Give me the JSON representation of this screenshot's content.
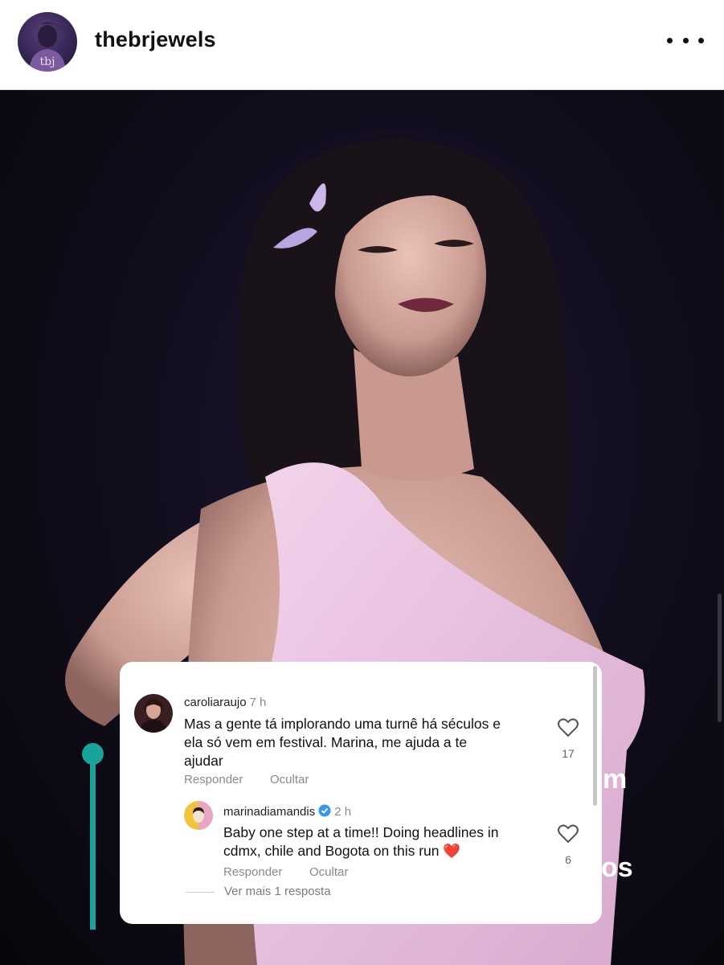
{
  "header": {
    "username": "thebrjewels",
    "avatar_text": "tbj",
    "more_icon": "more-horizontal-icon"
  },
  "overlay_text": {
    "fragment_1": "m",
    "fragment_2": "os"
  },
  "comments": [
    {
      "username": "caroliaraujo",
      "time": "7 h",
      "text_lines": [
        "Mas a gente tá implorando uma turnê há séculos e",
        "ela só vem em festival. Marina, me ajuda a te",
        "ajudar"
      ],
      "likes": "17",
      "reply_label": "Responder",
      "hide_label": "Ocultar"
    },
    {
      "username": "marinadiamandis",
      "verified": true,
      "time": "2 h",
      "text_lines": [
        "Baby one step at a time!! Doing headlines in",
        "cdmx, chile and Bogota on this run ❤️"
      ],
      "likes": "6",
      "reply_label": "Responder",
      "hide_label": "Ocultar"
    }
  ],
  "more_replies": "Ver mais 1 resposta",
  "colors": {
    "accent_teal": "#1aa39a",
    "verified_blue": "#3897f0",
    "heart_red": "#e0245e"
  }
}
